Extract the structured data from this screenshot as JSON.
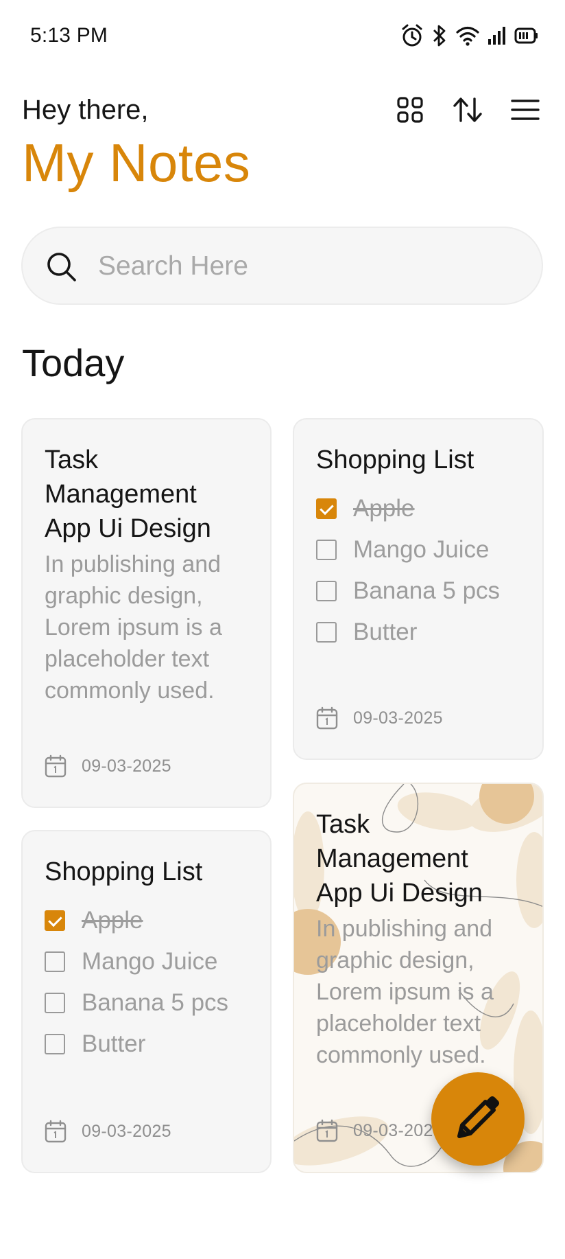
{
  "status_bar": {
    "time": "5:13 PM",
    "icons": [
      "alarm-icon",
      "bluetooth-icon",
      "wifi-icon",
      "signal-icon",
      "battery-icon"
    ]
  },
  "header": {
    "greeting": "Hey there,",
    "title": "My Notes",
    "actions": [
      "grid-view-icon",
      "sort-icon",
      "menu-icon"
    ]
  },
  "search": {
    "placeholder": "Search Here",
    "value": ""
  },
  "section": {
    "title": "Today"
  },
  "notes": [
    {
      "title_lines": [
        "Task",
        "Management",
        "App Ui Design"
      ],
      "body_lines": [
        "In publishing and",
        "graphic design,",
        "Lorem ipsum is a",
        "placeholder text",
        "commonly used."
      ],
      "date": "09-03-2025"
    },
    {
      "title": "Shopping List",
      "items": [
        {
          "label": "Apple",
          "checked": true
        },
        {
          "label": "Mango Juice",
          "checked": false
        },
        {
          "label": "Banana 5 pcs",
          "checked": false
        },
        {
          "label": "Butter",
          "checked": false
        }
      ],
      "date": "09-03-2025"
    },
    {
      "title": "Shopping List",
      "items": [
        {
          "label": "Apple",
          "checked": true
        },
        {
          "label": "Mango Juice",
          "checked": false
        },
        {
          "label": "Banana 5 pcs",
          "checked": false
        },
        {
          "label": "Butter",
          "checked": false
        }
      ],
      "date": "09-03-2025"
    },
    {
      "title_lines": [
        "Task",
        "Management",
        "App Ui Design"
      ],
      "body_lines": [
        "In publishing and",
        "graphic design,",
        "Lorem ipsum is a",
        "placeholder text",
        "commonly used."
      ],
      "date": "09-03-2025"
    }
  ],
  "fab": {
    "icon": "pencil-icon"
  },
  "colors": {
    "accent": "#d8860a",
    "card_bg": "#f6f6f6",
    "muted_text": "#9b9b9b"
  }
}
